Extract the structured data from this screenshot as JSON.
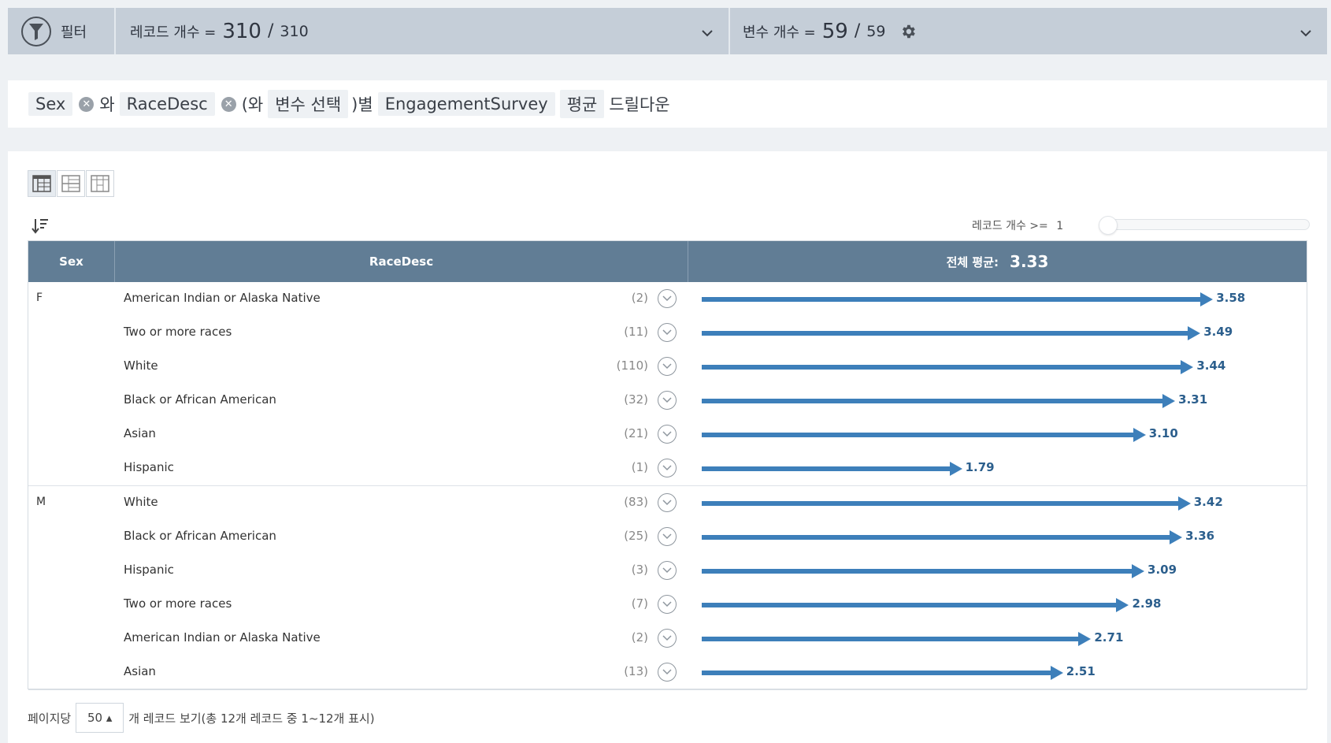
{
  "topbar": {
    "filter_label": "필터",
    "records_label": "레코드 개수 =",
    "records_value": "310",
    "records_sep": "/",
    "records_total": "310",
    "vars_label": "변수 개수 =",
    "vars_value": "59",
    "vars_sep": "/",
    "vars_total": "59"
  },
  "query": {
    "var1": "Sex",
    "conj1": "와",
    "var2": "RaceDesc",
    "paren_open": "(와",
    "var_select": "변수 선택",
    "paren_close": ")별",
    "target": "EngagementSurvey",
    "agg": "평균",
    "suffix": "드릴다운"
  },
  "controls": {
    "threshold_label": "레코드 개수 >=",
    "threshold_value": "1"
  },
  "table": {
    "headers": {
      "sex": "Sex",
      "race": "RaceDesc",
      "mean_label": "전체 평균:",
      "mean_value": "3.33"
    },
    "groups": [
      {
        "sex": "F",
        "rows": [
          {
            "race": "American Indian or Alaska Native",
            "count": "(2)",
            "value": "3.58"
          },
          {
            "race": "Two or more races",
            "count": "(11)",
            "value": "3.49"
          },
          {
            "race": "White",
            "count": "(110)",
            "value": "3.44"
          },
          {
            "race": "Black or African American",
            "count": "(32)",
            "value": "3.31"
          },
          {
            "race": "Asian",
            "count": "(21)",
            "value": "3.10"
          },
          {
            "race": "Hispanic",
            "count": "(1)",
            "value": "1.79"
          }
        ]
      },
      {
        "sex": "M",
        "rows": [
          {
            "race": "White",
            "count": "(83)",
            "value": "3.42"
          },
          {
            "race": "Black or African American",
            "count": "(25)",
            "value": "3.36"
          },
          {
            "race": "Hispanic",
            "count": "(3)",
            "value": "3.09"
          },
          {
            "race": "Two or more races",
            "count": "(7)",
            "value": "2.98"
          },
          {
            "race": "American Indian or Alaska Native",
            "count": "(2)",
            "value": "2.71"
          },
          {
            "race": "Asian",
            "count": "(13)",
            "value": "2.51"
          }
        ]
      }
    ]
  },
  "pager": {
    "per_page_label": "페이지당",
    "per_page_value": "50 ▴",
    "summary": "개 레코드 보기(총 12개 레코드 중 1~12개 표시)"
  },
  "colors": {
    "accent": "#3d7fba",
    "header_bg": "#617d95",
    "topbar_bg": "#c5ced8"
  }
}
